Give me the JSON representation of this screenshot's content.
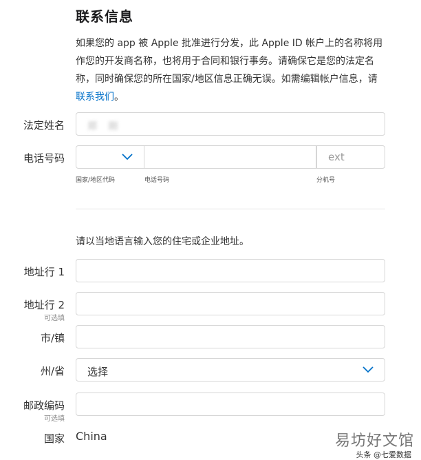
{
  "section": {
    "title": "联系信息",
    "intro_text": "如果您的 app 被 Apple 批准进行分发，此 Apple ID 帐户上的名称将用作您的开发商名称，也将用于合同和银行事务。请确保它是您的法定名称，同时确保您的所在国家/地区信息正确无误。如需编辑帐户信息，请",
    "intro_link": "联系我们",
    "intro_end": "。"
  },
  "form": {
    "legal_name": {
      "label": "法定姓名",
      "value": "郑 刚"
    },
    "phone": {
      "label": "电话号码",
      "country_code_caption": "国家/地区代码",
      "number_caption": "电话号码",
      "ext_placeholder": "ext",
      "ext_caption": "分机号"
    },
    "address_note": "请以当地语言输入您的住宅或企业地址。",
    "address1": {
      "label": "地址行 1",
      "value": ""
    },
    "address2": {
      "label": "地址行 2",
      "optional": "可选填",
      "value": ""
    },
    "city": {
      "label": "市/镇",
      "value": ""
    },
    "state": {
      "label": "州/省",
      "value": "选择"
    },
    "postal": {
      "label": "邮政编码",
      "optional": "可选填",
      "value": ""
    },
    "country": {
      "label": "国家",
      "value": "China"
    }
  },
  "watermark": {
    "main": "易坊好文馆",
    "sub": "头条 @七爱数据"
  },
  "colors": {
    "link": "#0070c9",
    "chevron": "#0070c9",
    "border": "#d6d6d6"
  }
}
